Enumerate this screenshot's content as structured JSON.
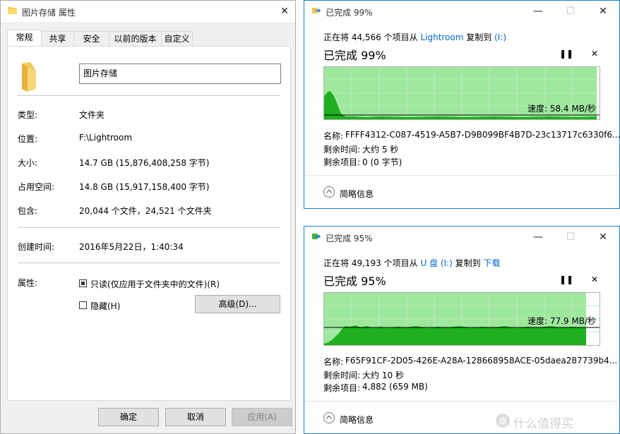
{
  "properties": {
    "window_title": "图片存储 属性",
    "close": "✕",
    "tabs": [
      "常规",
      "共享",
      "安全",
      "以前的版本",
      "自定义"
    ],
    "name": "图片存储",
    "rows": [
      {
        "label": "类型:",
        "value": "文件夹"
      },
      {
        "label": "位置:",
        "value": "F:\\Lightroom"
      },
      {
        "label": "大小:",
        "value": "14.7 GB (15,876,408,258 字节)"
      },
      {
        "label": "占用空间:",
        "value": "14.8 GB (15,917,158,400 字节)"
      },
      {
        "label": "包含:",
        "value": "20,044 个文件，24,521 个文件夹"
      },
      {
        "label": "创建时间:",
        "value": "2016年5月22日，1:40:34"
      }
    ],
    "attributes_label": "属性:",
    "readonly_label": "只读(仅应用于文件夹中的文件)(R)",
    "hidden_label": "隐藏(H)",
    "advanced_button": "高级(D)...",
    "ok_button": "确定",
    "cancel_button": "取消",
    "apply_button": "应用(A)"
  },
  "copy1": {
    "title": "已完成 99%",
    "desc_prefix": "正在将 44,566 个项目从",
    "source": "Lightroom",
    "desc_mid": "复制到",
    "dest": "(I:)",
    "status": "已完成 99%",
    "pause": "❚❚",
    "stop": "✕",
    "speed": "速度: 58.4 MB/秒",
    "name_label": "名称:",
    "name_value": "FFFF4312-C087-4519-A5B7-D9B099BF4B7D-23c13717c6330f6...",
    "time_label": "剩余时间:",
    "time_value": "大约 5 秒",
    "items_label": "剩余项目:",
    "items_value": "0 (0 字节)",
    "more": "简略信息",
    "progress": 0.99
  },
  "copy2": {
    "title": "已完成 95%",
    "desc_prefix": "正在将 49,193 个项目从",
    "source": "U 盘 (I:)",
    "desc_mid": "复制到",
    "dest": "下载",
    "status": "已完成 95%",
    "pause": "❚❚",
    "stop": "✕",
    "speed": "速度: 77.9 MB/秒",
    "name_label": "名称:",
    "name_value": "F65F91CF-2D05-426E-A28A-128668958ACE-05daea287739b4...",
    "time_label": "剩余时间:",
    "time_value": "大约 10 秒",
    "items_label": "剩余项目:",
    "items_value": "4,882 (659 MB)",
    "more": "简略信息",
    "progress": 0.95
  },
  "window_controls": {
    "minimize": "—",
    "maximize": "☐",
    "close": "✕"
  },
  "watermark": "值 什么值得买",
  "colors": {
    "accent": "#1883d7",
    "graph_fill": "#9ee89e",
    "graph_line": "#22b022",
    "link": "#0066cc"
  }
}
